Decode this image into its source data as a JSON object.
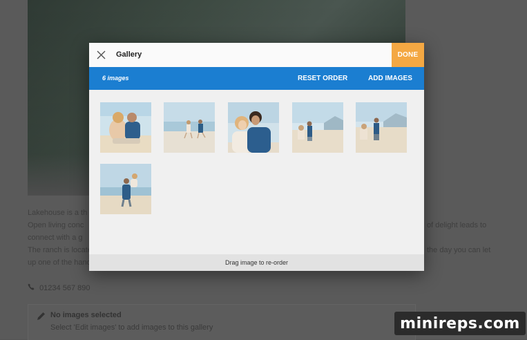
{
  "background_page": {
    "text_lines": [
      "Lakehouse is a th",
      "Open living conc",
      "of delight leads to",
      "connect with a g",
      "The ranch is locate",
      "the day you can let",
      "up one of the hand"
    ],
    "phone": "01234 567 890",
    "no_images": {
      "title": "No images selected",
      "subtitle": "Select 'Edit images' to add images to this gallery"
    }
  },
  "modal": {
    "title": "Gallery",
    "done_label": "DONE",
    "image_count": "6 images",
    "reset_label": "RESET ORDER",
    "add_label": "ADD IMAGES",
    "footer_hint": "Drag image to re-order",
    "images": [
      {
        "name": "couple sitting on sand"
      },
      {
        "name": "couple running on beach"
      },
      {
        "name": "couple embracing closeup"
      },
      {
        "name": "couple sitting on dune"
      },
      {
        "name": "proposal on beach"
      },
      {
        "name": "man lifting woman on beach"
      }
    ]
  },
  "watermark": "minireps.com",
  "colors": {
    "toolbar": "#1b7ed1",
    "done": "#f4a843",
    "overlay": "#545454"
  }
}
